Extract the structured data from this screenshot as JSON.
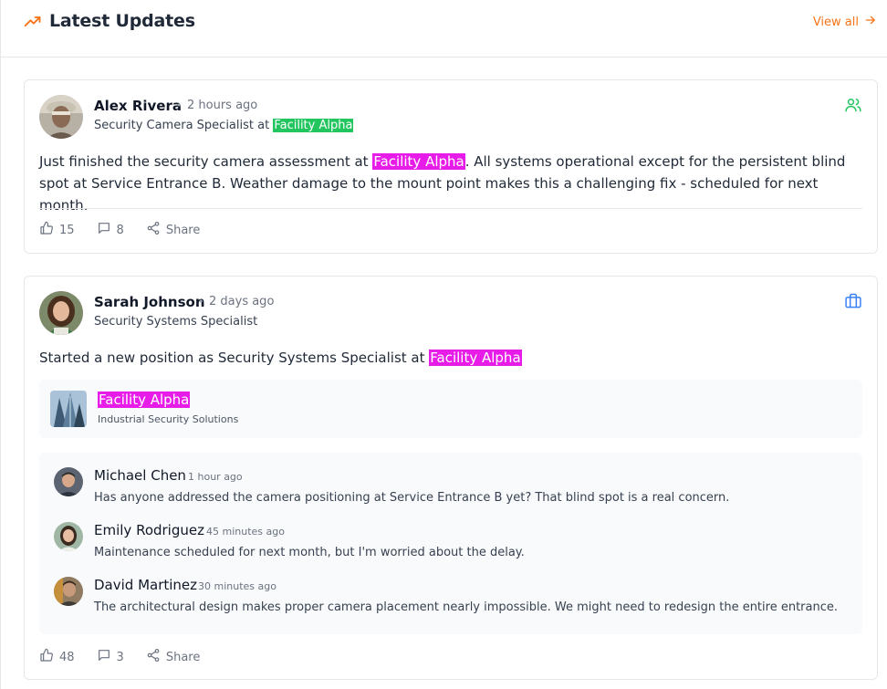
{
  "header": {
    "title": "Latest Updates",
    "view_all": "View all",
    "trend_icon": "trending-up-icon",
    "accent": "#f97316"
  },
  "posts": [
    {
      "author": "Alex Rivera",
      "time": "2 hours ago",
      "role_prefix": "Security Camera Specialist at",
      "role_org": "Facility Alpha",
      "type_icon": "users-icon",
      "text_before": "Just finished the security camera assessment at",
      "text_mention": "Facility Alpha",
      "text_after": ". All systems operational except for the persistent blind spot at Service Entrance B. Weather damage to the mount point makes this a challenging fix - scheduled for next month.",
      "likes": "15",
      "comments": "8",
      "share": "Share"
    },
    {
      "author": "Sarah Johnson",
      "time": "2 days ago",
      "role": "Security Systems Specialist",
      "type_icon": "briefcase-icon",
      "text_before": "Started a new position as Security Systems Specialist at",
      "text_mention": "Facility Alpha",
      "company": {
        "name": "Facility Alpha",
        "subtitle": "Industrial Security Solutions"
      },
      "comment_list": [
        {
          "name": "Michael Chen",
          "time": "1 hour ago",
          "text": "Has anyone addressed the camera positioning at Service Entrance B yet? That blind spot is a real concern."
        },
        {
          "name": "Emily Rodriguez",
          "time": "45 minutes ago",
          "text": "Maintenance scheduled for next month, but I'm worried about the delay."
        },
        {
          "name": "David Martinez",
          "time": "30 minutes ago",
          "text": "The architectural design makes proper camera placement nearly impossible. We might need to redesign the entire entrance."
        }
      ],
      "likes": "48",
      "comments": "3",
      "share": "Share"
    }
  ],
  "colors": {
    "highlight_green": "#22c55e",
    "highlight_pink": "#e81ce8",
    "users_icon": "#22c55e",
    "briefcase_icon": "#3b82f6"
  }
}
